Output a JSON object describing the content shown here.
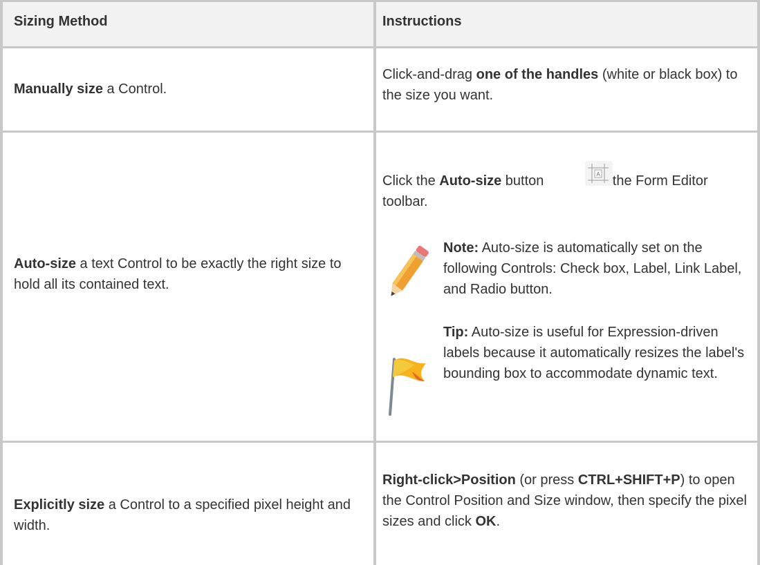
{
  "header": {
    "col1": "Sizing Method",
    "col2": "Instructions"
  },
  "rows": [
    {
      "method_bold": "Manually size",
      "method_rest": " a Control.",
      "instr_pre": "Click-and-drag ",
      "instr_bold": "one of the handles",
      "instr_post": " (white or black box) to the size you want."
    },
    {
      "method_bold": "Auto-size",
      "method_rest": " a text Control to be exactly the right size to hold all its contained text.",
      "instr_pre": "Click the ",
      "instr_bold": "Auto-size",
      "instr_mid": " button",
      "instr_post": " on the Form Editor toolbar.",
      "toolbar_icon_name": "auto-size-icon",
      "note_label": "Note:",
      "note_text": " Auto-size is automatically set on the following Controls: Check box, Label, Link Label, and Radio button.",
      "note_icon_name": "pencil-icon",
      "tip_label": "Tip:",
      "tip_text": " Auto-size is useful for Expression-driven labels because it automatically resizes the label's bounding box to accommodate dynamic text.",
      "tip_icon_name": "flag-icon"
    },
    {
      "method_bold": "Explicitly size",
      "method_rest": " a Control to a specified pixel height and width.",
      "instr_bold1": "Right-click>Position",
      "instr_mid1": " (or press ",
      "instr_bold2": "CTRL+SHIFT+P",
      "instr_mid2": ") to open the Control Position and Size window, then specify the pixel sizes and click ",
      "instr_bold3": "OK",
      "instr_post": "."
    }
  ],
  "colors": {
    "border": "#c8c8c8",
    "header_bg": "#f2f2f2",
    "text": "#333333",
    "pencil_body": "#f0a030",
    "flag": "#f7b21c"
  }
}
